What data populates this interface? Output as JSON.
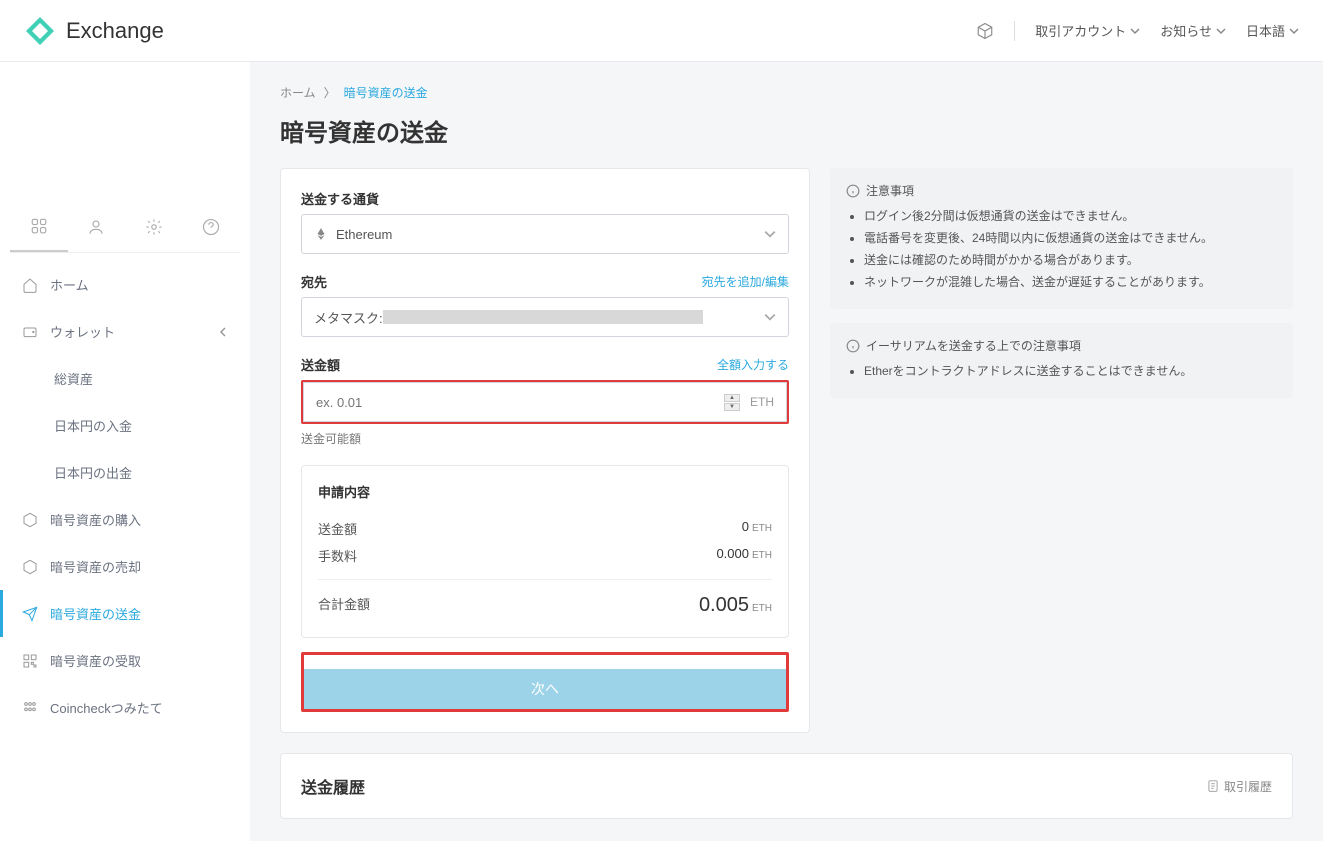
{
  "header": {
    "logo_text": "Exchange",
    "account": "取引アカウント",
    "notices": "お知らせ",
    "language": "日本語"
  },
  "sidebar": {
    "home": "ホーム",
    "wallet": "ウォレット",
    "children": {
      "total": "総資産",
      "jpy_in": "日本円の入金",
      "jpy_out": "日本円の出金"
    },
    "buy": "暗号資産の購入",
    "sell": "暗号資産の売却",
    "send": "暗号資産の送金",
    "receive": "暗号資産の受取",
    "tsumitate": "Coincheckつみたて"
  },
  "breadcrumb": {
    "home": "ホーム",
    "sep": "〉",
    "current": "暗号資産の送金"
  },
  "page_title": "暗号資産の送金",
  "form": {
    "currency_label": "送金する通貨",
    "currency_value": "Ethereum",
    "dest_label": "宛先",
    "dest_link": "宛先を追加/編集",
    "dest_value_prefix": "メタマスク: ",
    "amount_label": "送金額",
    "amount_link": "全額入力する",
    "amount_placeholder": "ex. 0.01",
    "amount_unit": "ETH",
    "amount_helper": "送金可能額"
  },
  "summary": {
    "title": "申請内容",
    "row_amount_label": "送金額",
    "row_amount_value": "0",
    "row_fee_label": "手数料",
    "row_fee_value": "0.000",
    "row_total_label": "合計金額",
    "row_total_value": "0.005",
    "unit": "ETH",
    "next": "次へ"
  },
  "notes1": {
    "title": "注意事項",
    "items": [
      "ログイン後2分間は仮想通貨の送金はできません。",
      "電話番号を変更後、24時間以内に仮想通貨の送金はできません。",
      "送金には確認のため時間がかかる場合があります。",
      "ネットワークが混雑した場合、送金が遅延することがあります。"
    ]
  },
  "notes2": {
    "title": "イーサリアムを送金する上での注意事項",
    "items": [
      "Etherをコントラクトアドレスに送金することはできません。"
    ]
  },
  "history": {
    "title": "送金履歴",
    "link": "取引履歴"
  }
}
